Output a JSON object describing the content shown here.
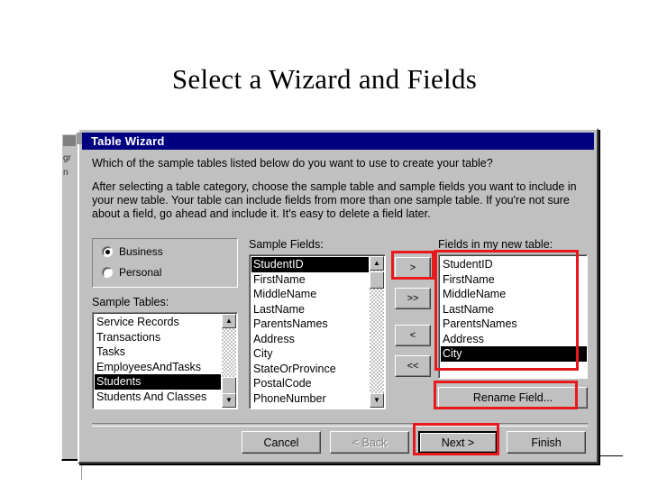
{
  "slide": {
    "title": "Select a Wizard and Fields"
  },
  "background_window": {
    "fragment_1": "gr",
    "fragment_2": "n"
  },
  "dialog": {
    "title": "Table Wizard",
    "titlebar_icon": "table-wizard-icon",
    "prompt_question": "Which of the sample tables listed below do you want to use to create your table?",
    "prompt_body": "After selecting a table category, choose the sample table and sample fields you want to include in your new table. Your table can include fields from more than one sample table. If you're not sure about a field, go ahead and include it. It's easy to delete a field later.",
    "category": {
      "options": [
        {
          "label": "Business",
          "selected": true
        },
        {
          "label": "Personal",
          "selected": false
        }
      ]
    },
    "sample_tables": {
      "label": "Sample Tables:",
      "items": [
        {
          "label": "Service Records",
          "selected": false
        },
        {
          "label": "Transactions",
          "selected": false
        },
        {
          "label": "Tasks",
          "selected": false
        },
        {
          "label": "EmployeesAndTasks",
          "selected": false
        },
        {
          "label": "Students",
          "selected": true
        },
        {
          "label": "Students And Classes",
          "selected": false
        }
      ],
      "scroll_up_icon": "triangle-up-icon",
      "scroll_down_icon": "triangle-down-icon"
    },
    "sample_fields": {
      "label": "Sample Fields:",
      "items": [
        {
          "label": "StudentID",
          "selected": true
        },
        {
          "label": "FirstName",
          "selected": false
        },
        {
          "label": "MiddleName",
          "selected": false
        },
        {
          "label": "LastName",
          "selected": false
        },
        {
          "label": "ParentsNames",
          "selected": false
        },
        {
          "label": "Address",
          "selected": false
        },
        {
          "label": "City",
          "selected": false
        },
        {
          "label": "StateOrProvince",
          "selected": false
        },
        {
          "label": "PostalCode",
          "selected": false
        },
        {
          "label": "PhoneNumber",
          "selected": false
        }
      ],
      "scroll_up_icon": "triangle-up-icon",
      "scroll_down_icon": "triangle-down-icon"
    },
    "new_fields": {
      "label": "Fields in my new table:",
      "items": [
        {
          "label": "StudentID",
          "selected": false
        },
        {
          "label": "FirstName",
          "selected": false
        },
        {
          "label": "MiddleName",
          "selected": false
        },
        {
          "label": "LastName",
          "selected": false
        },
        {
          "label": "ParentsNames",
          "selected": false
        },
        {
          "label": "Address",
          "selected": false
        },
        {
          "label": "City",
          "selected": true
        }
      ]
    },
    "transfer_buttons": {
      "add": ">",
      "add_all": ">>",
      "remove": "<",
      "remove_all": "<<"
    },
    "rename_button": "Rename Field...",
    "footer_buttons": {
      "cancel": "Cancel",
      "back": "< Back",
      "next": "Next >",
      "finish": "Finish"
    }
  },
  "annotations": {
    "accent_color": "#e8191b",
    "highlighted": [
      "add-button",
      "new-fields-listbox",
      "rename-field-button",
      "next-button"
    ]
  }
}
